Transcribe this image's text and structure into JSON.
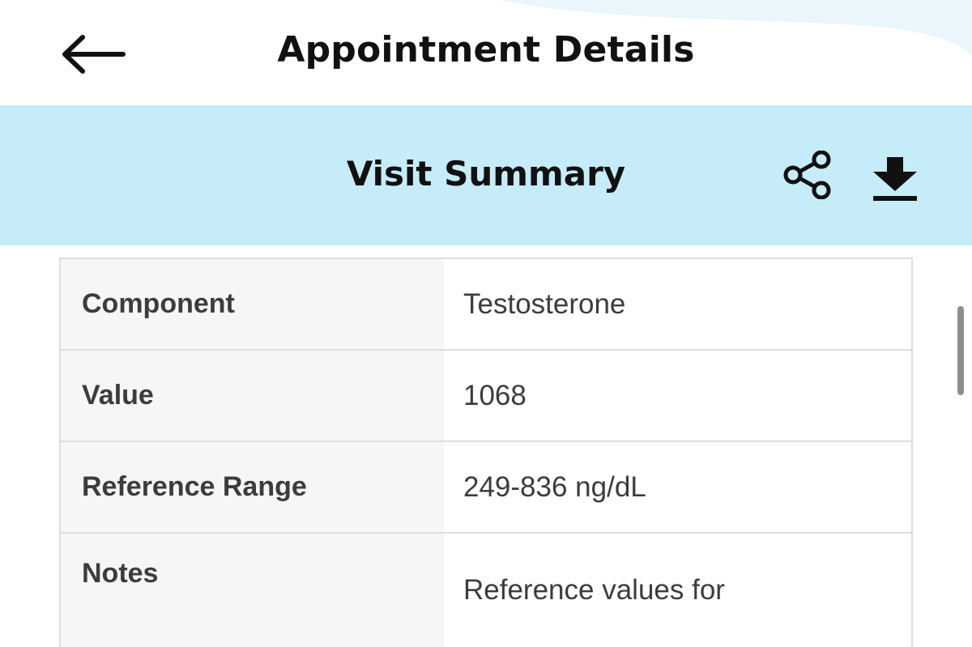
{
  "header": {
    "title": "Appointment Details",
    "back_icon": "arrow-left-icon"
  },
  "summary": {
    "title": "Visit Summary",
    "background": "#c6ecf9",
    "share_icon": "share-icon",
    "download_icon": "download-icon"
  },
  "table": {
    "rows": [
      {
        "label": "Component",
        "value": "Testosterone"
      },
      {
        "label": "Value",
        "value": "1068"
      },
      {
        "label": "Reference Range",
        "value": "249-836 ng/dL"
      },
      {
        "label": "Notes",
        "value": "Reference values for"
      }
    ]
  }
}
